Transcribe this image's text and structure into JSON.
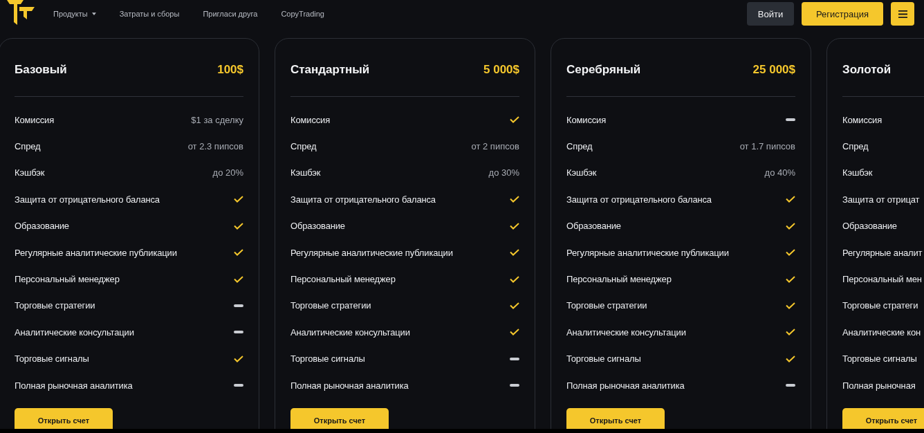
{
  "nav": {
    "items": [
      {
        "label": "Продукты",
        "dropdown": true
      },
      {
        "label": "Затраты и сборы",
        "dropdown": false
      },
      {
        "label": "Пригласи друга",
        "dropdown": false
      },
      {
        "label": "CopyTrading",
        "dropdown": false
      }
    ],
    "login": "Войти",
    "register": "Регистрация"
  },
  "plans": [
    {
      "name": "Базовый",
      "price": "100$",
      "button": "Открыть счет",
      "rows": [
        {
          "label": "Комиссия",
          "kind": "text",
          "value": "$1 за сделку"
        },
        {
          "label": "Спред",
          "kind": "text",
          "value": "от 2.3 пипсов"
        },
        {
          "label": "Кэшбэк",
          "kind": "text",
          "value": "до 20%"
        },
        {
          "label": "Защита от отрицательного баланса",
          "kind": "check"
        },
        {
          "label": "Образование",
          "kind": "check"
        },
        {
          "label": "Регулярные аналитические публикации",
          "kind": "check"
        },
        {
          "label": "Персональный менеджер",
          "kind": "check"
        },
        {
          "label": "Торговые стратегии",
          "kind": "dash"
        },
        {
          "label": "Аналитические консультации",
          "kind": "dash"
        },
        {
          "label": "Торговые сигналы",
          "kind": "check"
        },
        {
          "label": "Полная рыночная аналитика",
          "kind": "dash"
        }
      ]
    },
    {
      "name": "Стандартный",
      "price": "5 000$",
      "button": "Открыть счет",
      "rows": [
        {
          "label": "Комиссия",
          "kind": "check"
        },
        {
          "label": "Спред",
          "kind": "text",
          "value": "от 2 пипсов"
        },
        {
          "label": "Кэшбэк",
          "kind": "text",
          "value": "до 30%"
        },
        {
          "label": "Защита от отрицательного баланса",
          "kind": "check"
        },
        {
          "label": "Образование",
          "kind": "check"
        },
        {
          "label": "Регулярные аналитические публикации",
          "kind": "check"
        },
        {
          "label": "Персональный менеджер",
          "kind": "check"
        },
        {
          "label": "Торговые стратегии",
          "kind": "check"
        },
        {
          "label": "Аналитические консультации",
          "kind": "check"
        },
        {
          "label": "Торговые сигналы",
          "kind": "dash"
        },
        {
          "label": "Полная рыночная аналитика",
          "kind": "dash"
        }
      ]
    },
    {
      "name": "Серебряный",
      "price": "25 000$",
      "button": "Открыть счет",
      "rows": [
        {
          "label": "Комиссия",
          "kind": "dash"
        },
        {
          "label": "Спред",
          "kind": "text",
          "value": "от 1.7 пипсов"
        },
        {
          "label": "Кэшбэк",
          "kind": "text",
          "value": "до 40%"
        },
        {
          "label": "Защита от отрицательного баланса",
          "kind": "check"
        },
        {
          "label": "Образование",
          "kind": "check"
        },
        {
          "label": "Регулярные аналитические публикации",
          "kind": "check"
        },
        {
          "label": "Персональный менеджер",
          "kind": "check"
        },
        {
          "label": "Торговые стратегии",
          "kind": "check"
        },
        {
          "label": "Аналитические консультации",
          "kind": "check"
        },
        {
          "label": "Торговые сигналы",
          "kind": "check"
        },
        {
          "label": "Полная рыночная аналитика",
          "kind": "dash"
        }
      ]
    },
    {
      "name": "Золотой",
      "button": "Открыть счет",
      "rows": [
        {
          "label": "Комиссия"
        },
        {
          "label": "Спред"
        },
        {
          "label": "Кэшбэк"
        },
        {
          "label": "Защита от отрицат"
        },
        {
          "label": "Образование"
        },
        {
          "label": "Регулярные аналит"
        },
        {
          "label": "Персональный мен"
        },
        {
          "label": "Торговые стратеги"
        },
        {
          "label": "Аналитические кон"
        },
        {
          "label": "Торговые сигналы"
        },
        {
          "label": "Полная рыночная"
        }
      ]
    }
  ]
}
